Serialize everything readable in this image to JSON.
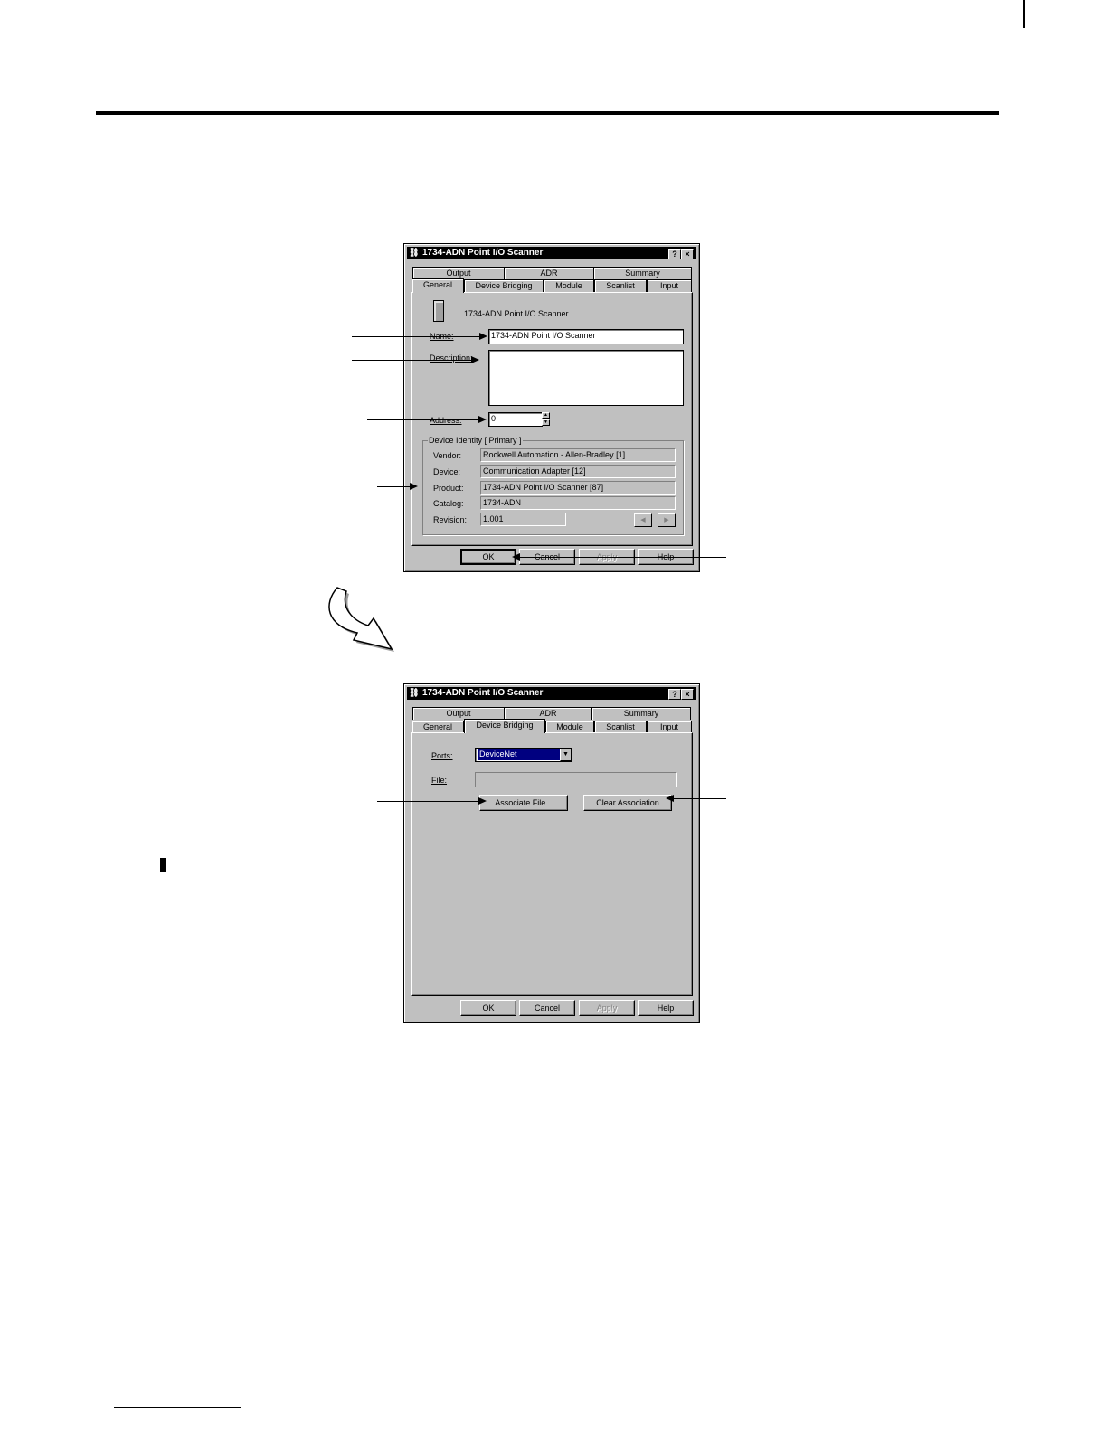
{
  "dialog_general": {
    "title": "1734-ADN Point I/O Scanner",
    "help_glyph": "?",
    "close_glyph": "×",
    "tabs_back": [
      "Output",
      "ADR",
      "Summary"
    ],
    "tabs_front": [
      "General",
      "Device Bridging",
      "Module",
      "Scanlist",
      "Input"
    ],
    "device_caption": "1734-ADN Point I/O Scanner",
    "name_label": "Name:",
    "name_value": "1734-ADN Point I/O Scanner",
    "description_label": "Description:",
    "description_value": "",
    "address_label": "Address:",
    "address_value": "0",
    "identity_group": "Device Identity [ Primary ]",
    "vendor_label": "Vendor:",
    "vendor_value": "Rockwell Automation - Allen-Bradley [1]",
    "device_label": "Device:",
    "device_value": "Communication Adapter [12]",
    "product_label": "Product:",
    "product_value": "1734-ADN Point I/O Scanner [87]",
    "catalog_label": "Catalog:",
    "catalog_value": "1734-ADN",
    "revision_label": "Revision:",
    "revision_value": "1.001",
    "ok": "OK",
    "cancel": "Cancel",
    "apply": "Apply",
    "help": "Help"
  },
  "dialog_bridging": {
    "title": "1734-ADN Point I/O Scanner",
    "help_glyph": "?",
    "close_glyph": "×",
    "tabs_back": [
      "Output",
      "ADR",
      "Summary"
    ],
    "tabs_front": [
      "General",
      "Device Bridging",
      "Module",
      "Scanlist",
      "Input"
    ],
    "ports_label": "Ports:",
    "ports_value": "DeviceNet",
    "file_label": "File:",
    "file_value": "",
    "associate_file": "Associate File...",
    "clear_association": "Clear Association",
    "ok": "OK",
    "cancel": "Cancel",
    "apply": "Apply",
    "help": "Help"
  },
  "icons": {
    "app": "network-scanner-icon",
    "device": "point-io-adapter-icon",
    "flow_arrow": "curved-down-arrow-icon"
  }
}
